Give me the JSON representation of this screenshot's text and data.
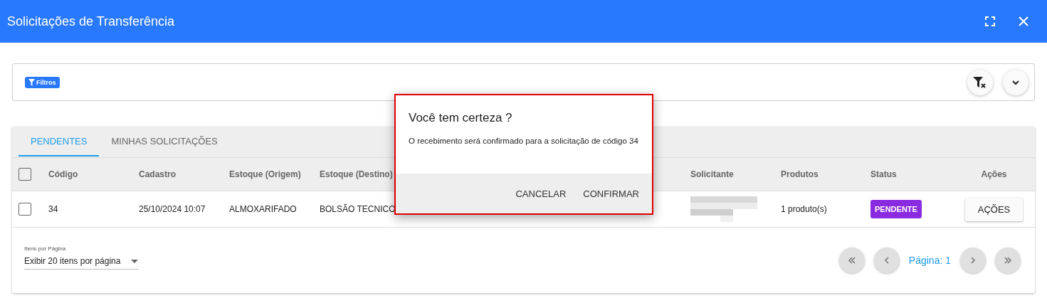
{
  "window": {
    "title": "Solicitações de Transferência"
  },
  "filters": {
    "label": "Filtros"
  },
  "tabs": [
    {
      "label": "PENDENTES",
      "selected": true
    },
    {
      "label": "MINHAS SOLICITAÇÕES",
      "selected": false
    }
  ],
  "table": {
    "select_all_checked": false,
    "columns": [
      "Código",
      "Cadastro",
      "Estoque (Origem)",
      "Estoque (Destino)",
      "",
      "Solicitante",
      "Produtos",
      "Status",
      "Ações"
    ],
    "rows": [
      {
        "checked": false,
        "codigo": "34",
        "cadastro": "25/10/2024 10:07",
        "origem": "ALMOXARIFADO",
        "destino": "BOLSÃO TECNICO",
        "produtos": "1 produto(s)",
        "status": "PENDENTE",
        "action": "AÇÕES"
      }
    ]
  },
  "pagination": {
    "label": "Itens por Página",
    "value": "Exibir 20 itens por página",
    "page": "Página: 1"
  },
  "dialog": {
    "title": "Você tem certeza ?",
    "message": "O recebimento será confirmado para a solicitação de código 34",
    "buttons": [
      "CANCELAR",
      "CONFIRMAR"
    ]
  }
}
